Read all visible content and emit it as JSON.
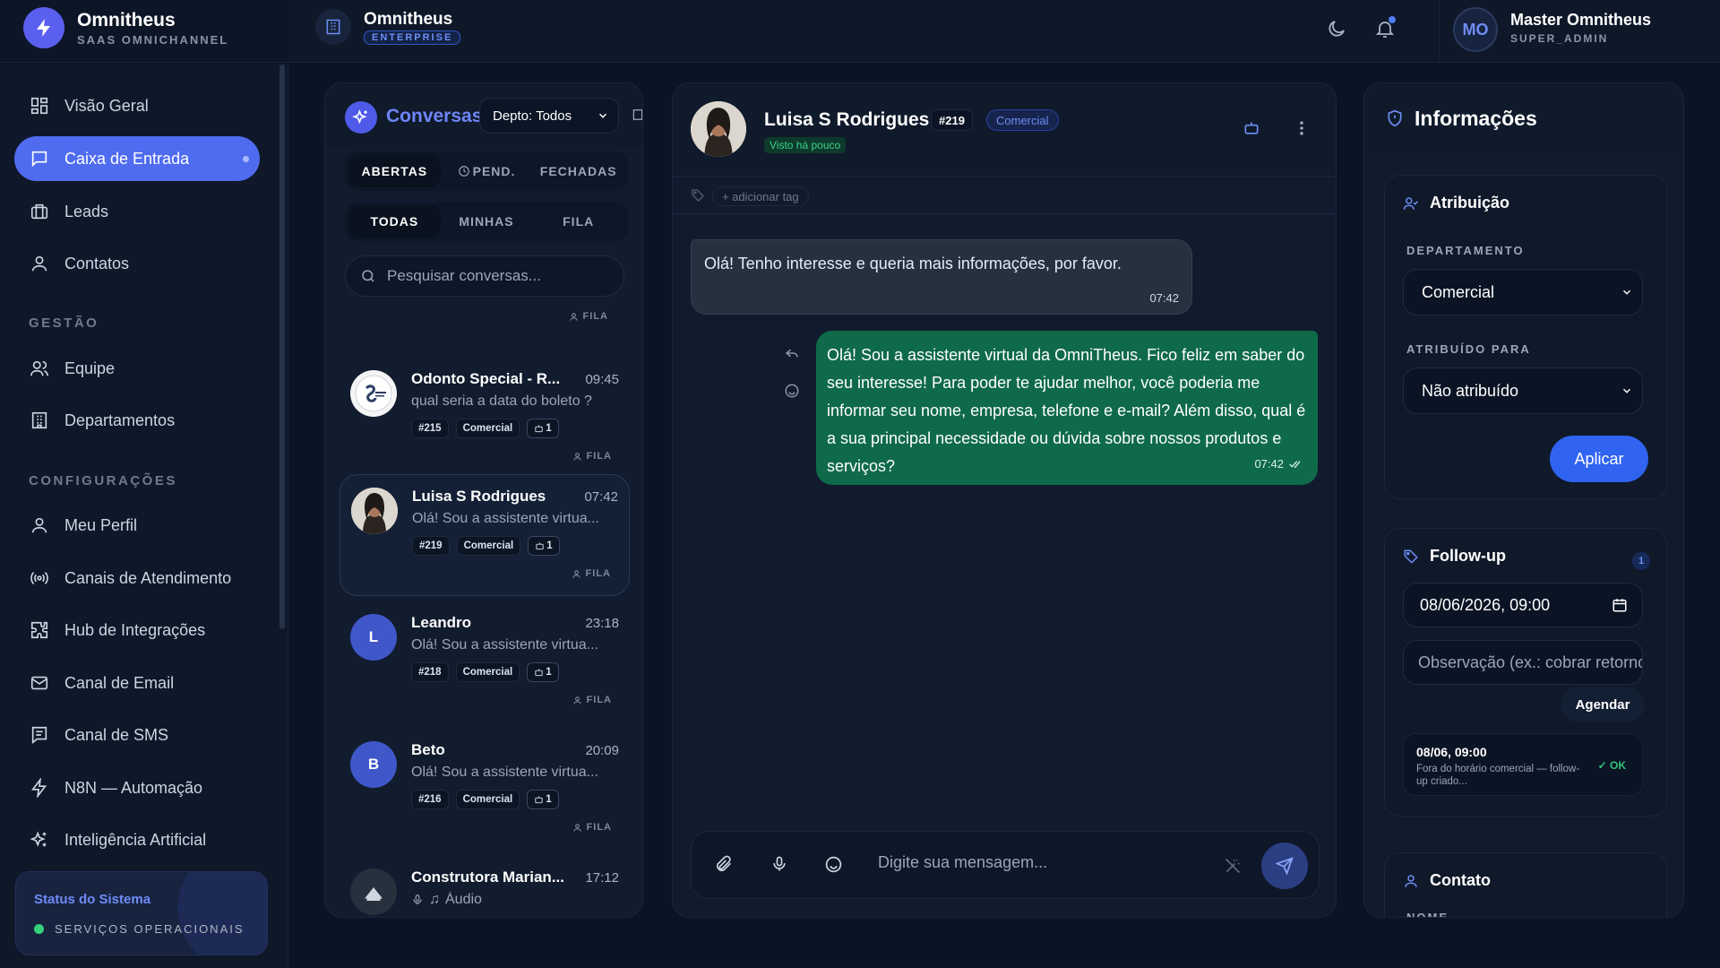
{
  "brand": {
    "name": "Omnitheus",
    "subtitle": "SAAS OMNICHANNEL"
  },
  "sidebar": {
    "main_items": [
      {
        "label": "Visão Geral",
        "icon": "grid-icon",
        "active": false
      },
      {
        "label": "Caixa de Entrada",
        "icon": "message-square-icon",
        "active": true
      },
      {
        "label": "Leads",
        "icon": "briefcase-icon",
        "active": false
      },
      {
        "label": "Contatos",
        "icon": "user-icon",
        "active": false
      }
    ],
    "section_gestao": "GESTÃO",
    "gestao_items": [
      {
        "label": "Equipe",
        "icon": "users-icon"
      },
      {
        "label": "Departamentos",
        "icon": "building-icon"
      }
    ],
    "section_config": "CONFIGURAÇÕES",
    "config_items": [
      {
        "label": "Meu Perfil",
        "icon": "user-icon"
      },
      {
        "label": "Canais de Atendimento",
        "icon": "radio-icon"
      },
      {
        "label": "Hub de Integrações",
        "icon": "puzzle-icon"
      },
      {
        "label": "Canal de Email",
        "icon": "mail-icon"
      },
      {
        "label": "Canal de SMS",
        "icon": "sms-icon"
      },
      {
        "label": "N8N — Automação",
        "icon": "zap-icon"
      },
      {
        "label": "Inteligência Artificial",
        "icon": "sparkles-icon"
      }
    ],
    "status": {
      "title": "Status do Sistema",
      "text": "SERVIÇOS OPERACIONAIS",
      "color": "#34d07c"
    }
  },
  "topbar": {
    "company": "Omnitheus",
    "plan_badge": "ENTERPRISE",
    "user_initials": "MO",
    "user_name": "Master Omnitheus",
    "user_role": "SUPER_ADMIN"
  },
  "conversations": {
    "title": "Conversas",
    "department_filter": "Depto: Todos",
    "status_tabs": [
      "ABERTAS",
      "PEND.",
      "FECHADAS"
    ],
    "scope_tabs": [
      "TODAS",
      "MINHAS",
      "FILA"
    ],
    "search_placeholder": "Pesquisar conversas...",
    "top_queue_label": "FILA",
    "items": [
      {
        "name": "Odonto Special - R...",
        "time": "09:45",
        "preview": "qual seria a data do boleto ?",
        "number": "#215",
        "department": "Comercial",
        "count": "1",
        "queue": "FILA",
        "avatar_letter": ""
      },
      {
        "name": "Luisa S Rodrigues",
        "time": "07:42",
        "preview": "Olá! Sou a assistente virtua...",
        "number": "#219",
        "department": "Comercial",
        "count": "1",
        "queue": "FILA",
        "avatar_letter": "",
        "selected": true
      },
      {
        "name": "Leandro",
        "time": "23:18",
        "preview": "Olá! Sou a assistente virtua...",
        "number": "#218",
        "department": "Comercial",
        "count": "1",
        "queue": "FILA",
        "avatar_letter": "L"
      },
      {
        "name": "Beto",
        "time": "20:09",
        "preview": "Olá! Sou a assistente virtua...",
        "number": "#216",
        "department": "Comercial",
        "count": "1",
        "queue": "FILA",
        "avatar_letter": "B"
      },
      {
        "name": "Construtora Marian...",
        "time": "17:12",
        "preview": "Áudio",
        "avatar_letter": ""
      }
    ]
  },
  "chat": {
    "contact_name": "Luisa S Rodrigues",
    "ticket_number": "#219",
    "department": "Comercial",
    "seen": "Visto há pouco",
    "add_tag": "+ adicionar tag",
    "messages": [
      {
        "direction": "in",
        "text": "Olá! Tenho interesse e queria mais informações, por favor.",
        "time": "07:42"
      },
      {
        "direction": "out",
        "text": "Olá! Sou a assistente virtual da OmniTheus. Fico feliz em saber do seu interesse! Para poder te ajudar melhor, você poderia me informar seu nome, empresa, telefone e e-mail? Além disso, qual é a sua principal necessidade ou dúvida sobre nossos produtos e serviços?",
        "time": "07:42"
      }
    ],
    "composer_placeholder": "Digite sua mensagem..."
  },
  "info": {
    "title": "Informações",
    "assignment": {
      "title": "Atribuição",
      "department_label": "DEPARTAMENTO",
      "department_value": "Comercial",
      "assigned_label": "ATRIBUÍDO PARA",
      "assigned_value": "Não atribuído",
      "apply": "Aplicar"
    },
    "followup": {
      "title": "Follow-up",
      "count": "1",
      "date_value": "08/06/2026, 09:00",
      "note_placeholder": "Observação (ex.: cobrar retorno)",
      "schedule": "Agendar",
      "entry": {
        "date": "08/06, 09:00",
        "note": "Fora do horário comercial — follow-up criado...",
        "status": "✓ OK"
      }
    },
    "contact": {
      "title": "Contato",
      "name_label": "NOME"
    }
  },
  "colors": {
    "accent": "#4f6cf0",
    "outgoing_bubble": "#0f6a4a",
    "background": "#0b1424"
  }
}
